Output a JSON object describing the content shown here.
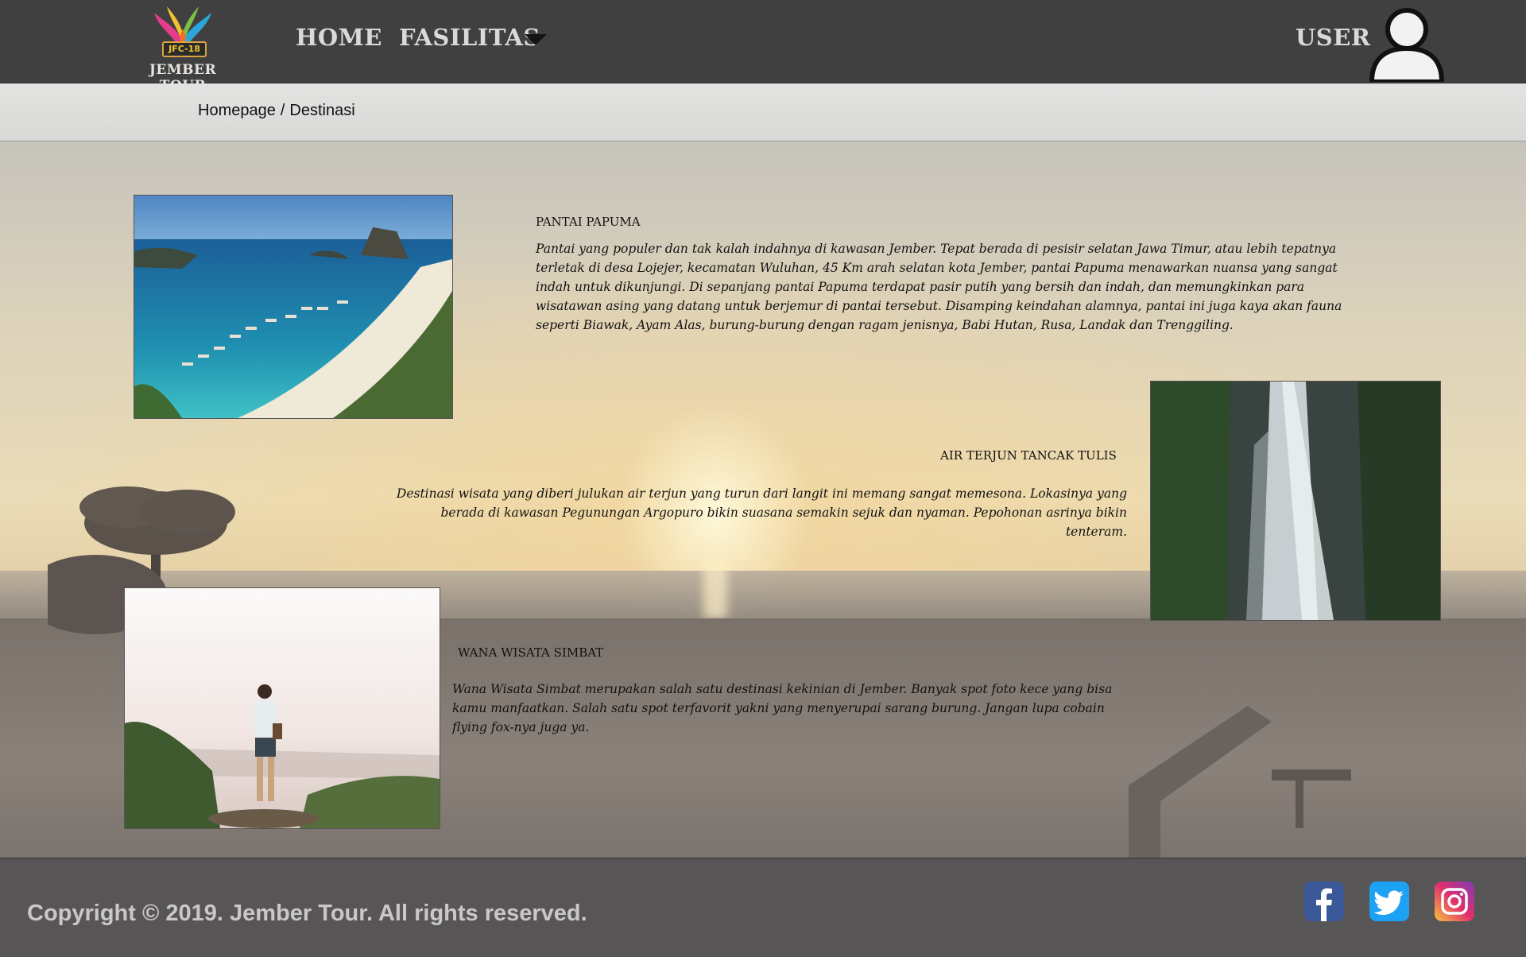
{
  "navbar": {
    "logo_badge": "JFC-18",
    "logo_text": "JEMBER TOUR",
    "home": "HOME",
    "fasilitas": "FASILITAS",
    "user": "USER",
    "icons": [
      "chevron-down-icon",
      "user-avatar-icon"
    ]
  },
  "breadcrumb": {
    "home": "Homepage",
    "separator": "/",
    "current": "Destinasi"
  },
  "destinations": [
    {
      "title": "PANTAI PAPUMA",
      "description": " Pantai yang populer dan tak kalah indahnya di kawasan Jember. Tepat berada di pesisir selatan Jawa Timur, atau lebih tepatnya terletak di desa Lojejer, kecamatan Wuluhan, 45 Km arah selatan kota Jember, pantai Papuma menawarkan nuansa yang sangat indah untuk dikunjungi. Di sepanjang pantai Papuma terdapat pasir putih yang bersih dan indah, dan memungkinkan para wisatawan asing yang datang untuk berjemur di pantai tersebut. Disamping keindahan alamnya, pantai ini juga kaya akan fauna seperti Biawak, Ayam Alas, burung-burung dengan ragam jenisnya, Babi Hutan, Rusa, Landak dan Trenggiling."
    },
    {
      "title": "AIR TERJUN TANCAK TULIS",
      "description": "Destinasi wisata yang diberi julukan air terjun yang turun dari langit ini memang sangat memesona. Lokasinya yang berada di kawasan Pegunungan Argopuro bikin suasana semakin sejuk dan nyaman. Pepohonan asrinya bikin tenteram."
    },
    {
      "title": "WANA WISATA SIMBAT",
      "description": "Wana Wisata Simbat merupakan salah satu destinasi kekinian di Jember. Banyak spot foto kece yang bisa kamu manfaatkan. Salah satu spot terfavorit yakni yang menyerupai sarang burung. Jangan lupa cobain flying fox-nya juga ya."
    }
  ],
  "footer": {
    "copyright": "Copyright © 2019. Jember Tour. All rights reserved.",
    "social": [
      "facebook-icon",
      "twitter-icon",
      "instagram-icon"
    ]
  },
  "colors": {
    "navbar_bg": "#414041",
    "breadcrumb_bg": "#dddddc",
    "footer_bg": "#585556",
    "facebook": "#3b5998",
    "twitter": "#1da1f2"
  }
}
